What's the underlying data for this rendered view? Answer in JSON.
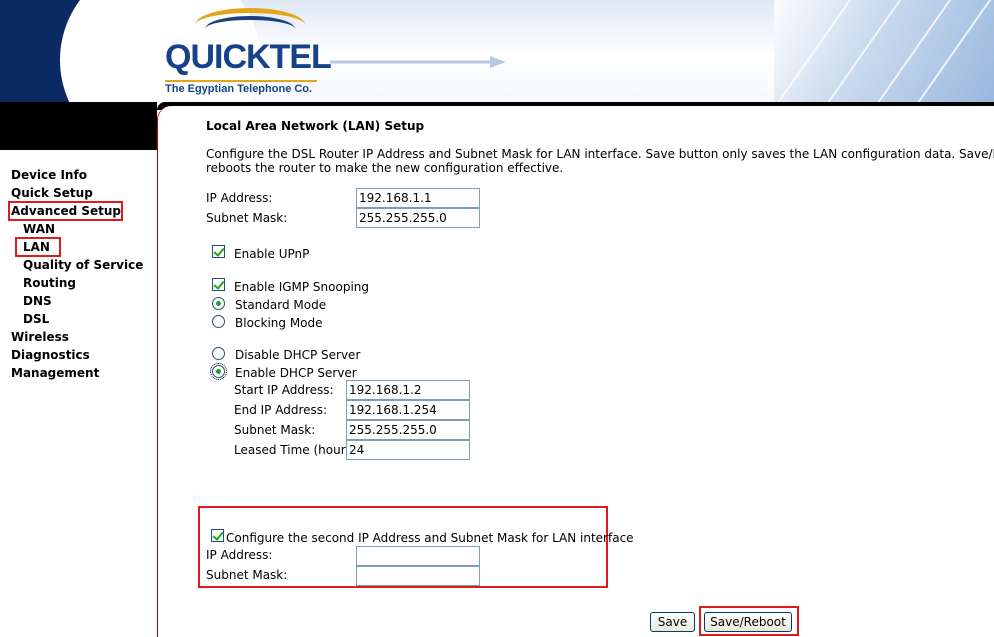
{
  "brand": {
    "logo_text": "QUICKTEL",
    "tagline": "The Egyptian Telephone Co."
  },
  "sidebar": {
    "items": [
      {
        "label": "Device Info"
      },
      {
        "label": "Quick Setup"
      },
      {
        "label": "Advanced Setup",
        "highlighted": true
      },
      {
        "label": "WAN"
      },
      {
        "label": "LAN",
        "highlighted": true
      },
      {
        "label": "Quality of Service"
      },
      {
        "label": "Routing"
      },
      {
        "label": "DNS"
      },
      {
        "label": "DSL"
      },
      {
        "label": "Wireless"
      },
      {
        "label": "Diagnostics"
      },
      {
        "label": "Management"
      }
    ]
  },
  "page": {
    "title": "Local Area Network (LAN) Setup",
    "description_line1": "Configure the DSL Router IP Address and Subnet Mask for LAN interface.  Save button only saves the LAN configuration data.  Save/Reboot bu",
    "description_line2": "reboots the router to make the new configuration effective."
  },
  "lan": {
    "ip_label": "IP Address:",
    "ip_value": "192.168.1.1",
    "mask_label": "Subnet Mask:",
    "mask_value": "255.255.255.0"
  },
  "options": {
    "upnp_label": "Enable UPnP",
    "upnp_checked": true,
    "igmp_label": "Enable IGMP Snooping",
    "igmp_checked": true,
    "standard_mode_label": "Standard Mode",
    "blocking_mode_label": "Blocking Mode",
    "igmp_mode": "Standard Mode"
  },
  "dhcp": {
    "disable_label": "Disable DHCP Server",
    "enable_label": "Enable DHCP Server",
    "mode": "Enable DHCP Server",
    "start_label": "Start IP Address:",
    "start_value": "192.168.1.2",
    "end_label": "End IP Address:",
    "end_value": "192.168.1.254",
    "mask_label": "Subnet Mask:",
    "mask_value": "255.255.255.0",
    "lease_label": "Leased Time (hour):",
    "lease_value": "24"
  },
  "second_ip": {
    "checkbox_label": "Configure the second IP Address and Subnet Mask for LAN interface",
    "checked": true,
    "ip_label": "IP Address:",
    "ip_value": "",
    "mask_label": "Subnet Mask:",
    "mask_value": ""
  },
  "buttons": {
    "save": "Save",
    "save_reboot": "Save/Reboot"
  },
  "colors": {
    "highlight_box": "#e01b1b",
    "brand_blue": "#16428a",
    "brand_gold": "#e3a61a"
  }
}
